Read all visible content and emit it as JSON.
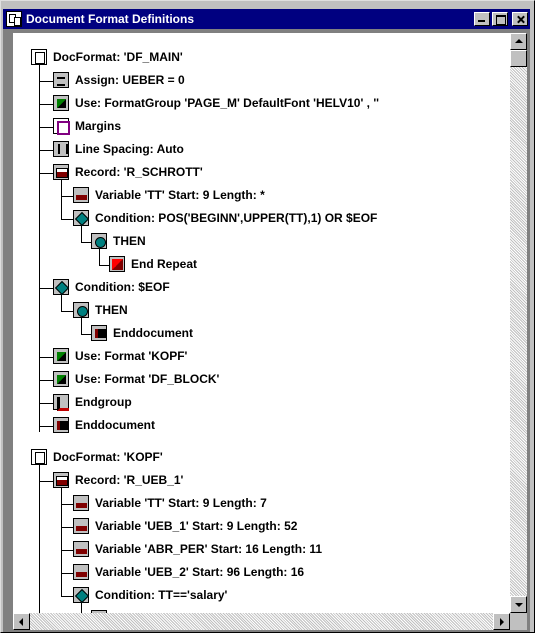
{
  "window": {
    "title": "Document Format Definitions",
    "icon": "document-icon",
    "buttons": {
      "minimize": "minimize-icon",
      "maximize": "maximize-icon",
      "close": "close-icon"
    }
  },
  "tree": {
    "nodes": [
      {
        "label": "DocFormat: 'DF_MAIN'",
        "icon": "docformat"
      },
      {
        "label": "Assign: UEBER = 0",
        "icon": "assign"
      },
      {
        "label": "Use: FormatGroup 'PAGE_M' DefaultFont 'HELV10' , ''",
        "icon": "use"
      },
      {
        "label": "Margins",
        "icon": "margins"
      },
      {
        "label": "Line Spacing: Auto",
        "icon": "linespacing"
      },
      {
        "label": "Record: 'R_SCHROTT'",
        "icon": "record"
      },
      {
        "label": "Variable 'TT' Start: 9 Length: *",
        "icon": "variable"
      },
      {
        "label": "Condition: POS('BEGINN',UPPER(TT),1) OR $EOF",
        "icon": "condition"
      },
      {
        "label": "THEN",
        "icon": "then"
      },
      {
        "label": "End Repeat",
        "icon": "endrepeat"
      },
      {
        "label": "Condition: $EOF",
        "icon": "condition"
      },
      {
        "label": "THEN",
        "icon": "then"
      },
      {
        "label": "Enddocument",
        "icon": "enddoc"
      },
      {
        "label": "Use: Format 'KOPF'",
        "icon": "use"
      },
      {
        "label": "Use: Format 'DF_BLOCK'",
        "icon": "use"
      },
      {
        "label": "Endgroup",
        "icon": "endgroup"
      },
      {
        "label": "Enddocument",
        "icon": "enddoc"
      },
      {
        "label": "DocFormat: 'KOPF'",
        "icon": "docformat"
      },
      {
        "label": "Record: 'R_UEB_1'",
        "icon": "record"
      },
      {
        "label": "Variable 'TT' Start: 9 Length: 7",
        "icon": "variable"
      },
      {
        "label": "Variable 'UEB_1' Start: 9 Length: 52",
        "icon": "variable"
      },
      {
        "label": "Variable 'ABR_PER' Start: 16 Length: 11",
        "icon": "variable"
      },
      {
        "label": "Variable 'UEB_2' Start: 96 Length: 16",
        "icon": "variable"
      },
      {
        "label": "Condition: TT=='salary'",
        "icon": "condition"
      },
      {
        "label": "THEN",
        "icon": "then"
      }
    ]
  },
  "scrollbars": {
    "up": "scroll-up-icon",
    "down": "scroll-down-icon",
    "left": "scroll-left-icon",
    "right": "scroll-right-icon"
  }
}
